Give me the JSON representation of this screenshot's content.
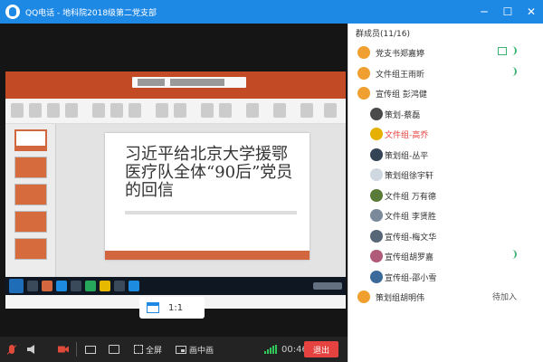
{
  "window": {
    "title": "QQ电话 - 地科院2018级第二党支部",
    "minimize": "─",
    "maximize": "☐",
    "close": "✕"
  },
  "slide": {
    "headline": "习近平给北京大学援鄂医疗队全体“90后”党员的回信"
  },
  "ratio": {
    "label": "1:1"
  },
  "controls": {
    "fullscreen_label": "全屏",
    "pip_label": "画中画",
    "timer": "00:46",
    "hangup_label": "退出"
  },
  "members": {
    "header": "群成员(11/16)",
    "list": [
      {
        "name": "党支书郑嘉婷",
        "avatar_color": "#f0a030",
        "indent": false,
        "current": false,
        "screen": true,
        "voice": true,
        "wait": ""
      },
      {
        "name": "文件组王雨昕",
        "avatar_color": "#f0a030",
        "indent": false,
        "current": false,
        "screen": false,
        "voice": true,
        "wait": ""
      },
      {
        "name": "宣传组 彭鸿健",
        "avatar_color": "#f0a030",
        "indent": false,
        "current": false,
        "screen": false,
        "voice": false,
        "wait": ""
      },
      {
        "name": "策划-蔡磊",
        "avatar_color": "#4a4a4a",
        "indent": true,
        "current": false,
        "screen": false,
        "voice": false,
        "wait": ""
      },
      {
        "name": "文件组-高乔",
        "avatar_color": "#e6b000",
        "indent": true,
        "current": true,
        "screen": false,
        "voice": false,
        "wait": ""
      },
      {
        "name": "策划组-丛平",
        "avatar_color": "#334455",
        "indent": true,
        "current": false,
        "screen": false,
        "voice": false,
        "wait": ""
      },
      {
        "name": "策划组徐宇轩",
        "avatar_color": "#cfd8e0",
        "indent": true,
        "current": false,
        "screen": false,
        "voice": false,
        "wait": ""
      },
      {
        "name": "文件组 万有德",
        "avatar_color": "#5a7a3a",
        "indent": true,
        "current": false,
        "screen": false,
        "voice": false,
        "wait": ""
      },
      {
        "name": "文件组 李贤胜",
        "avatar_color": "#7a8a9a",
        "indent": true,
        "current": false,
        "screen": false,
        "voice": false,
        "wait": ""
      },
      {
        "name": "宣传组-梅文华",
        "avatar_color": "#556677",
        "indent": true,
        "current": false,
        "screen": false,
        "voice": false,
        "wait": ""
      },
      {
        "name": "宣传组胡罗嘉",
        "avatar_color": "#b05a7a",
        "indent": true,
        "current": false,
        "screen": false,
        "voice": true,
        "wait": ""
      },
      {
        "name": "宣传组-邵小雪",
        "avatar_color": "#3a6a9a",
        "indent": true,
        "current": false,
        "screen": false,
        "voice": false,
        "wait": ""
      },
      {
        "name": "策划组胡明伟",
        "avatar_color": "#f0a030",
        "indent": false,
        "current": false,
        "screen": false,
        "voice": false,
        "wait": "待加入"
      }
    ]
  },
  "colors": {
    "titlebar": "#1e88e5",
    "hangup": "#e64340",
    "ppt_accent": "#d2663f",
    "current_member": "#e64340"
  }
}
